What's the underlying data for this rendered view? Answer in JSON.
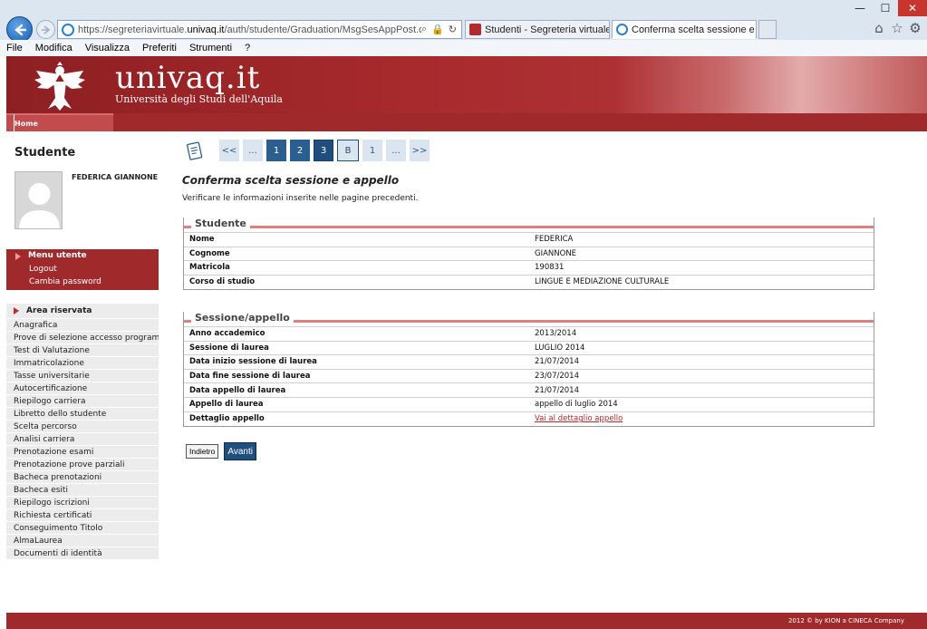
{
  "browser": {
    "url_prefix": "https://segreteriavirtuale.",
    "url_domain": "univaq.it",
    "url_suffix": "/auth/studente/Graduation/MsgSesAppPost.do",
    "tabs": [
      {
        "label": "Studenti - Segreteria virtuale"
      },
      {
        "label": "Conferma scelta sessione e ..."
      }
    ],
    "tab_close": "✕",
    "window": {
      "minimize": "—",
      "maximize": "☐",
      "close": "✕"
    },
    "menu": [
      "File",
      "Modifica",
      "Visualizza",
      "Preferiti",
      "Strumenti",
      "?"
    ]
  },
  "header": {
    "brand": "univaq.it",
    "brand_sub": "Università degli Studi dell'Aquila",
    "home_tab": "Home"
  },
  "sidebar": {
    "title": "Studente",
    "student_name": "FEDERICA GIANNONE",
    "user_menu": {
      "head": "Menu utente",
      "items": [
        "Logout",
        "Cambia password"
      ]
    },
    "area": {
      "head": "Area riservata",
      "items": [
        "Anagrafica",
        "Prove di selezione accesso programmato",
        "Test di Valutazione",
        "Immatricolazione",
        "Tasse universitarie",
        "Autocertificazione",
        "Riepilogo carriera",
        "Libretto dello studente",
        "Scelta percorso",
        "Analisi carriera",
        "Prenotazione esami",
        "Prenotazione prove parziali",
        "Bacheca prenotazioni",
        "Bacheca esiti",
        "Riepilogo iscrizioni",
        "Richiesta certificati",
        "Conseguimento Titolo",
        "AlmaLaurea",
        "Documenti di identità"
      ]
    }
  },
  "pager": {
    "items": [
      "<<",
      "...",
      "1",
      "2",
      "3",
      "B",
      "1",
      "...",
      ">>"
    ]
  },
  "main": {
    "title": "Conferma scelta sessione e appello",
    "description": "Verificare le informazioni inserite nelle pagine precedenti.",
    "student_section": {
      "title": "Studente",
      "rows": [
        {
          "label": "Nome",
          "value": "FEDERICA"
        },
        {
          "label": "Cognome",
          "value": "GIANNONE"
        },
        {
          "label": "Matricola",
          "value": "190831"
        },
        {
          "label": "Corso di studio",
          "value": "LINGUE E MEDIAZIONE CULTURALE"
        }
      ]
    },
    "session_section": {
      "title": "Sessione/appello",
      "rows": [
        {
          "label": "Anno accademico",
          "value": "2013/2014"
        },
        {
          "label": "Sessione di laurea",
          "value": "LUGLIO 2014"
        },
        {
          "label": "Data inizio sessione di laurea",
          "value": "21/07/2014"
        },
        {
          "label": "Data fine sessione di laurea",
          "value": "23/07/2014"
        },
        {
          "label": "Data appello di laurea",
          "value": "21/07/2014"
        },
        {
          "label": "Appello di laurea",
          "value": "appello di luglio 2014"
        },
        {
          "label": "Dettaglio appello",
          "value": "Vai al dettaglio appello"
        }
      ]
    },
    "buttons": {
      "back": "Indietro",
      "next": "Avanti"
    }
  },
  "footer": {
    "text": "2012 © by KION a CINECA Company"
  },
  "colors": {
    "brand_red": "#a0292c",
    "accent_blue": "#1f4f7e",
    "section_line": "#e07f81"
  }
}
